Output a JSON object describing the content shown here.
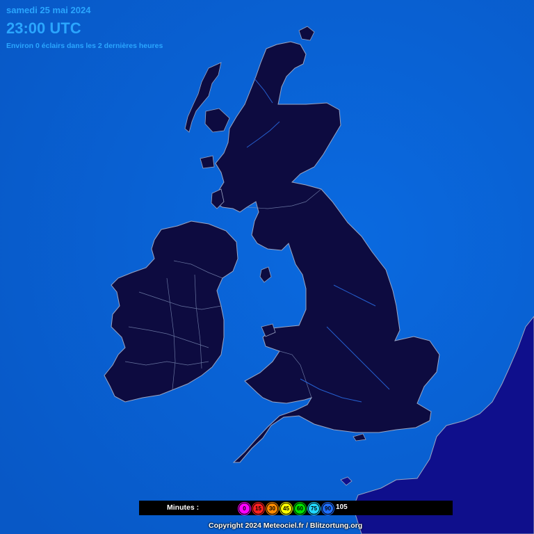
{
  "header": {
    "date": "samedi 25 mai 2024",
    "time": "23:00 UTC",
    "strike_count": "Environ 0 éclairs dans les 2 dernières heures"
  },
  "legend": {
    "label": "Minutes :",
    "chips": [
      {
        "value": "0",
        "color": "#ff00ff"
      },
      {
        "value": "15",
        "color": "#ff2020"
      },
      {
        "value": "30",
        "color": "#ff8a00"
      },
      {
        "value": "45",
        "color": "#ffff00"
      },
      {
        "value": "60",
        "color": "#00e000"
      },
      {
        "value": "75",
        "color": "#22d6ff"
      },
      {
        "value": "90",
        "color": "#1e6eff"
      }
    ],
    "last": "105"
  },
  "footer": {
    "copyright": "Copyright 2024 Meteociel.fr / Blitzortung.org"
  },
  "colors": {
    "sea": "#0a64d8",
    "land": "#0d0b40",
    "continent": "#0f0f8c",
    "border": "#9aa4c2",
    "text_accent": "#2aa6ff"
  }
}
